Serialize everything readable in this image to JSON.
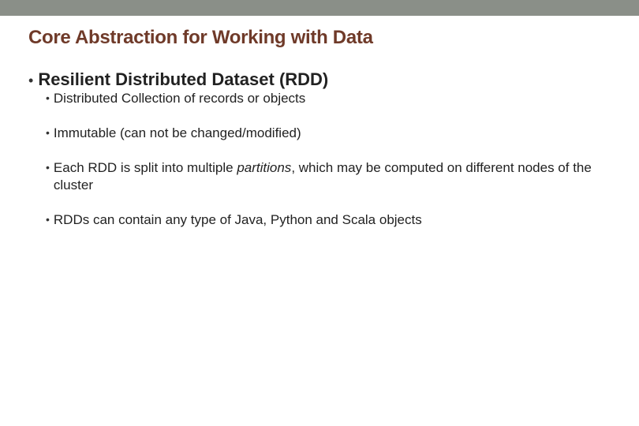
{
  "title": "Core Abstraction for Working with Data",
  "heading": "Resilient Distributed Dataset (RDD)",
  "bullets": {
    "b0": "Distributed Collection of records or objects",
    "b1": "Immutable (can not be changed/modified)",
    "b2_pre": "Each RDD is split into multiple ",
    "b2_em": "partitions",
    "b2_post": ", which may be computed on different nodes of the cluster",
    "b3": "RDDs can contain any type of Java, Python and Scala objects"
  }
}
